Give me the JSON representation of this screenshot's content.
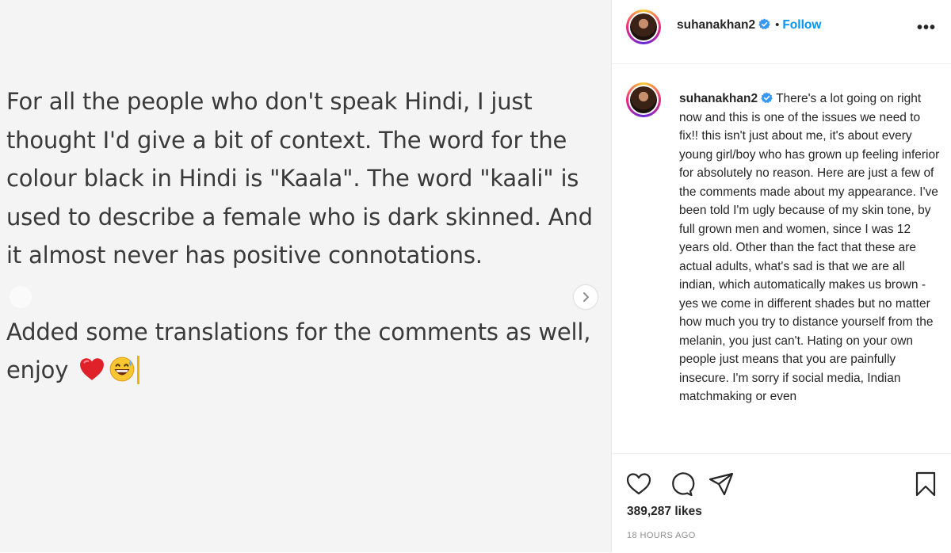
{
  "post_image": {
    "paragraph_1": "For all the people who don't speak Hindi, I just thought I'd give a bit of context. The word for the colour black in Hindi is \"Kaala\". The word \"kaali\" is used to describe a female who is dark skinned. And it almost never has positive connotations.",
    "paragraph_2": "Added some translations for the comments as well, enjoy",
    "emojis": [
      "red-heart",
      "grinning-sweat"
    ]
  },
  "header": {
    "username": "suhanakhan2",
    "separator": "•",
    "follow_label": "Follow",
    "more_label": "•••"
  },
  "caption": {
    "username": "suhanakhan2",
    "text": "There's a lot going on right now and this is one of the issues we need to fix!! this isn't just about me, it's about every young girl/boy who has grown up feeling inferior for absolutely no reason. Here are just a few of the comments made about my appearance. I've been told I'm ugly because of my skin tone, by full grown men and women, since I was 12 years old. Other than the fact that these are actual adults, what's sad is that we are all indian, which automatically makes us brown - yes we come in different shades but no matter how much you try to distance yourself from the melanin, you just can't. Hating on your own people just means that you are painfully insecure. I'm sorry if social media, Indian matchmaking or even"
  },
  "actions": {
    "likes": "389,287 likes",
    "timestamp": "18 HOURS AGO"
  },
  "colors": {
    "accent": "#0095f6",
    "text": "#262626",
    "muted": "#8e8e8e",
    "image_bg": "#f4f4f4"
  }
}
